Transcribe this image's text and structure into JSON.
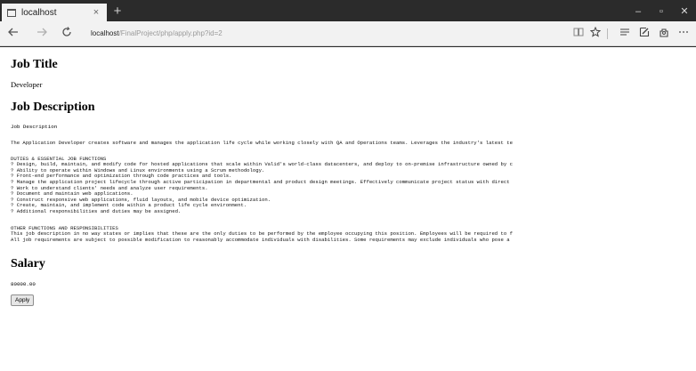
{
  "browser": {
    "tab_title": "localhost",
    "tab_close": "×",
    "new_tab": "+",
    "window_controls": {
      "minimize": "–",
      "maximize": "▫",
      "close": "✕"
    },
    "address": {
      "host": "localhost",
      "path": "/FinalProject/php/apply.php?id=2"
    },
    "icons": [
      "page-icon",
      "back-icon",
      "forward-icon",
      "refresh-icon",
      "reading-view-icon",
      "favorite-star-icon",
      "hub-icon",
      "notes-icon",
      "share-icon",
      "more-icon"
    ]
  },
  "job": {
    "title_heading": "Job Title",
    "title_value": "Developer",
    "description_heading": "Job Description",
    "description_label": "Job Description",
    "intro": "The Application Developer creates software and manages the application life cycle while working closely with QA and Operations teams. Leverages the industry's latest te",
    "duties_heading": "DUTIES & ESSENTIAL JOB FUNCTIONS",
    "duties": [
      "? Design, build, maintain, and modify code for hosted applications that scale within Valid's world-class datacenters, and deploy to on-premise infrastructure owned by c",
      "? Ability to operate within Windows and Linux environments using a Scrum methodology.",
      "? Front-end performance and optimization through code practices and tools.",
      "? Manage the application project lifecycle through active participation in departmental and product design meetings. Effectively communicate project status with direct",
      "? Work to understand clients' needs and analyze user requirements.",
      "? Document and maintain web applications.",
      "? Construct responsive web applications, fluid layouts, and mobile device optimization.",
      "? Create, maintain, and implement code within a product life cycle environment.",
      "? Additional responsibilities and duties may be assigned."
    ],
    "other_heading": "OTHER FUNCTIONS AND RESPONSIBILITIES",
    "other_lines": [
      "This job description in no way states or implies that these are the only duties to be performed by the employee occupying this position. Employees will be required to f",
      "All job requirements are subject to possible modification to reasonably accommodate individuals with disabilities. Some requirements may exclude individuals who pose a"
    ],
    "salary_heading": "Salary",
    "salary_value": "80000.00",
    "apply_label": "Apply"
  }
}
